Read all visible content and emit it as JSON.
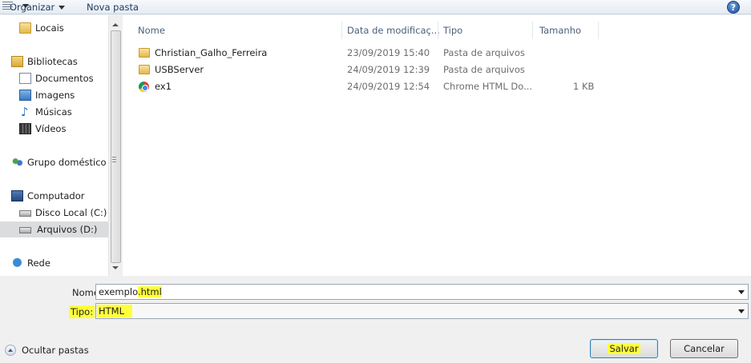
{
  "toolbar": {
    "organize_label": "Organizar",
    "new_folder_label": "Nova pasta",
    "help_label": "?"
  },
  "nav": {
    "items": [
      {
        "label": "Locais",
        "icon": "folder-icon"
      },
      {
        "label": "Bibliotecas",
        "icon": "libraries-icon"
      },
      {
        "label": "Documentos",
        "icon": "documents-icon"
      },
      {
        "label": "Imagens",
        "icon": "pictures-icon"
      },
      {
        "label": "Músicas",
        "icon": "music-icon"
      },
      {
        "label": "Vídeos",
        "icon": "videos-icon"
      },
      {
        "label": "Grupo doméstico",
        "icon": "homegroup-icon"
      },
      {
        "label": "Computador",
        "icon": "computer-icon"
      },
      {
        "label": "Disco Local (C:)",
        "icon": "drive-icon"
      },
      {
        "label": "Arquivos (D:)",
        "icon": "drive-icon",
        "selected": true
      },
      {
        "label": "Rede",
        "icon": "network-icon"
      }
    ]
  },
  "list": {
    "columns": [
      "Nome",
      "Data de modificaç...",
      "Tipo",
      "Tamanho"
    ],
    "rows": [
      {
        "name": "Christian_Galho_Ferreira",
        "date": "23/09/2019 15:40",
        "type": "Pasta de arquivos",
        "size": "",
        "icon": "folder-icon"
      },
      {
        "name": "USBServer",
        "date": "24/09/2019 12:39",
        "type": "Pasta de arquivos",
        "size": "",
        "icon": "folder-icon"
      },
      {
        "name": "ex1",
        "date": "24/09/2019 12:54",
        "type": "Chrome HTML Do...",
        "size": "1 KB",
        "icon": "chrome-icon"
      }
    ]
  },
  "form": {
    "name_label": "Nome:",
    "name_value_base": "exemplo",
    "name_value_ext": ".html",
    "type_label": "Tipo:",
    "type_value": "HTML"
  },
  "footer": {
    "hide_folders_label": "Ocultar pastas",
    "save_label": "Salvar",
    "cancel_label": "Cancelar"
  },
  "colors": {
    "highlight": "#ffff3c",
    "toolbar_text": "#1e395b"
  }
}
